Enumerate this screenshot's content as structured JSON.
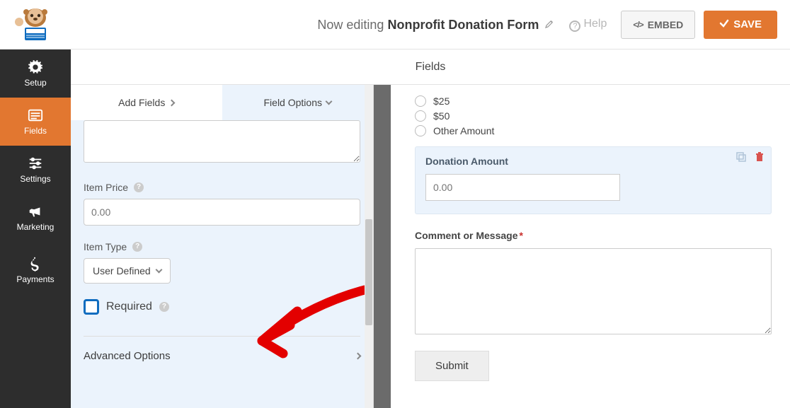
{
  "header": {
    "editing_prefix": "Now editing",
    "form_name": "Nonprofit Donation Form",
    "help_label": "Help",
    "embed_label": "EMBED",
    "save_label": "SAVE"
  },
  "sidebar": {
    "items": [
      {
        "label": "Setup"
      },
      {
        "label": "Fields"
      },
      {
        "label": "Settings"
      },
      {
        "label": "Marketing"
      },
      {
        "label": "Payments"
      }
    ]
  },
  "content_header": "Fields",
  "tabs": {
    "add_fields": "Add Fields",
    "field_options": "Field Options"
  },
  "options": {
    "item_price_label": "Item Price",
    "item_price_placeholder": "0.00",
    "item_type_label": "Item Type",
    "item_type_value": "User Defined",
    "required_label": "Required",
    "advanced_label": "Advanced Options"
  },
  "preview": {
    "radios": [
      "$25",
      "$50",
      "Other Amount"
    ],
    "donation_label": "Donation Amount",
    "donation_placeholder": "0.00",
    "comment_label": "Comment or Message",
    "required_asterisk": "*",
    "submit_label": "Submit"
  }
}
